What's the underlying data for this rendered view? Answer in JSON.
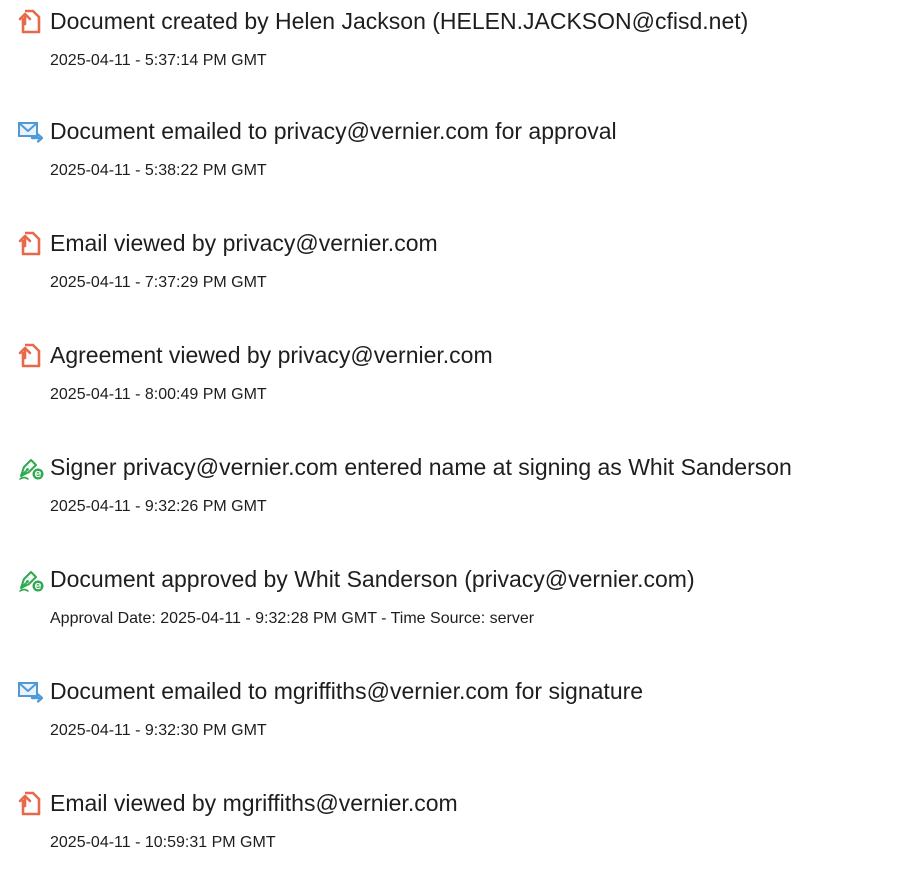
{
  "colors": {
    "document_icon": "#e8694a",
    "email_icon": "#4f9ad6",
    "signer_icon": "#2fa84f"
  },
  "events": [
    {
      "icon": "document-icon",
      "title": "Document created by Helen Jackson (HELEN.JACKSON@cfisd.net)",
      "detail": "2025-04-11 - 5:37:14 PM GMT"
    },
    {
      "icon": "email-icon",
      "title": "Document emailed to privacy@vernier.com for approval",
      "detail": "2025-04-11 - 5:38:22 PM GMT"
    },
    {
      "icon": "document-icon",
      "title": "Email viewed by privacy@vernier.com",
      "detail": "2025-04-11 - 7:37:29 PM GMT"
    },
    {
      "icon": "document-icon",
      "title": "Agreement viewed by privacy@vernier.com",
      "detail": "2025-04-11 - 8:00:49 PM GMT"
    },
    {
      "icon": "signer-icon",
      "title": "Signer privacy@vernier.com entered name at signing as Whit Sanderson",
      "detail": "2025-04-11 - 9:32:26 PM GMT"
    },
    {
      "icon": "signer-icon",
      "title": "Document approved by Whit Sanderson (privacy@vernier.com)",
      "detail": "Approval Date: 2025-04-11 - 9:32:28 PM GMT - Time Source: server"
    },
    {
      "icon": "email-icon",
      "title": "Document emailed to mgriffiths@vernier.com for signature",
      "detail": "2025-04-11 - 9:32:30 PM GMT"
    },
    {
      "icon": "document-icon",
      "title": "Email viewed by mgriffiths@vernier.com",
      "detail": "2025-04-11 - 10:59:31 PM GMT"
    }
  ]
}
